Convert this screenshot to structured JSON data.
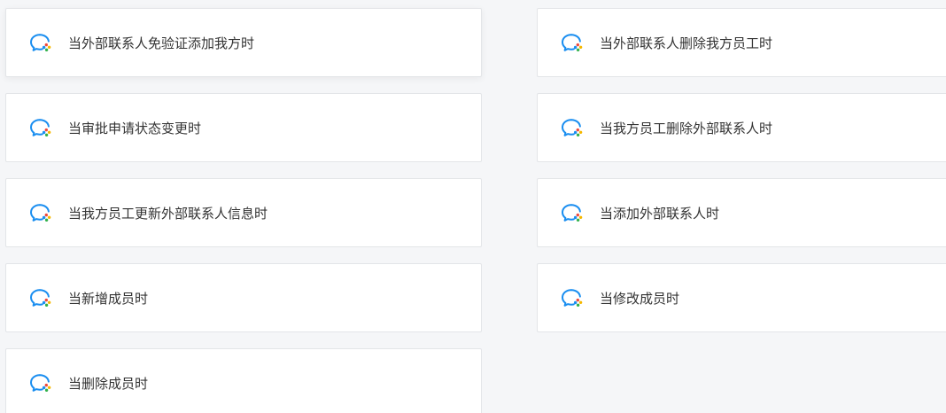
{
  "cards": [
    {
      "label": "当外部联系人免验证添加我方时"
    },
    {
      "label": "当外部联系人删除我方员工时"
    },
    {
      "label": "当审批申请状态变更时"
    },
    {
      "label": "当我方员工删除外部联系人时"
    },
    {
      "label": "当我方员工更新外部联系人信息时"
    },
    {
      "label": "当添加外部联系人时"
    },
    {
      "label": "当新增成员时"
    },
    {
      "label": "当修改成员时"
    },
    {
      "label": "当删除成员时"
    }
  ],
  "icon": "wecom-chat-icon",
  "colors": {
    "background": "#f5f6f8",
    "card": "#ffffff",
    "border": "#e3e5e8",
    "text": "#333333",
    "icon_blue": "#1a8ef0",
    "icon_red": "#f04a3c",
    "icon_yellow": "#f5b800",
    "icon_green": "#33b14b"
  }
}
